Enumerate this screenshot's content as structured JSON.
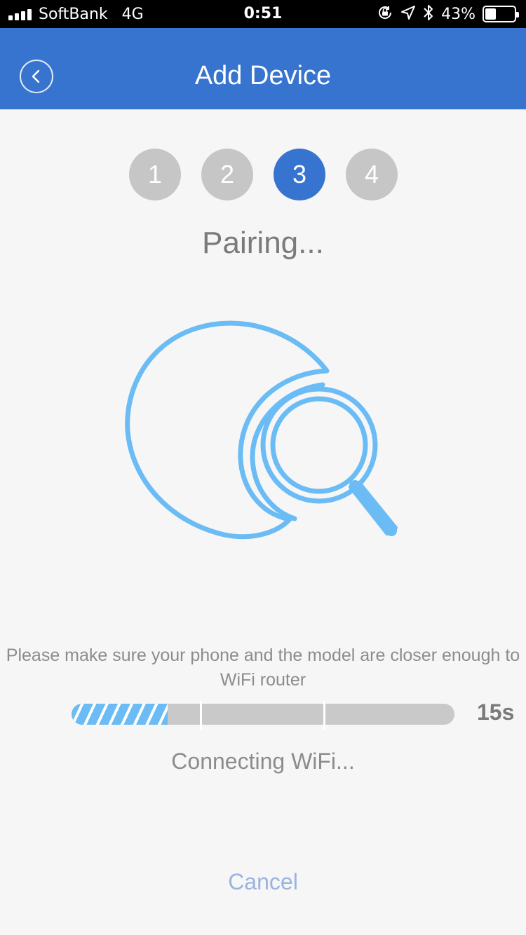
{
  "status_bar": {
    "carrier": "SoftBank",
    "network": "4G",
    "time": "0:51",
    "battery_percent": "43%",
    "battery_level": 0.43,
    "icons": [
      "signal-icon",
      "orientation-lock-icon",
      "location-icon",
      "bluetooth-icon",
      "battery-icon"
    ]
  },
  "header": {
    "title": "Add Device",
    "back_icon": "chevron-left-icon"
  },
  "steps": {
    "items": [
      {
        "label": "1",
        "active": false
      },
      {
        "label": "2",
        "active": false
      },
      {
        "label": "3",
        "active": true
      },
      {
        "label": "4",
        "active": false
      }
    ]
  },
  "main": {
    "title": "Pairing...",
    "illustration": "search-device-icon",
    "instruction": "Please make sure your phone and the model are closer enough to WiFi router",
    "progress": {
      "fraction": 0.25,
      "countdown": "15s"
    },
    "status": "Connecting WiFi...",
    "cancel_label": "Cancel"
  },
  "colors": {
    "accent": "#3774cf",
    "step_inactive": "#c6c6c6",
    "illustration": "#6bbcf5",
    "cancel": "#9ab3e1"
  }
}
